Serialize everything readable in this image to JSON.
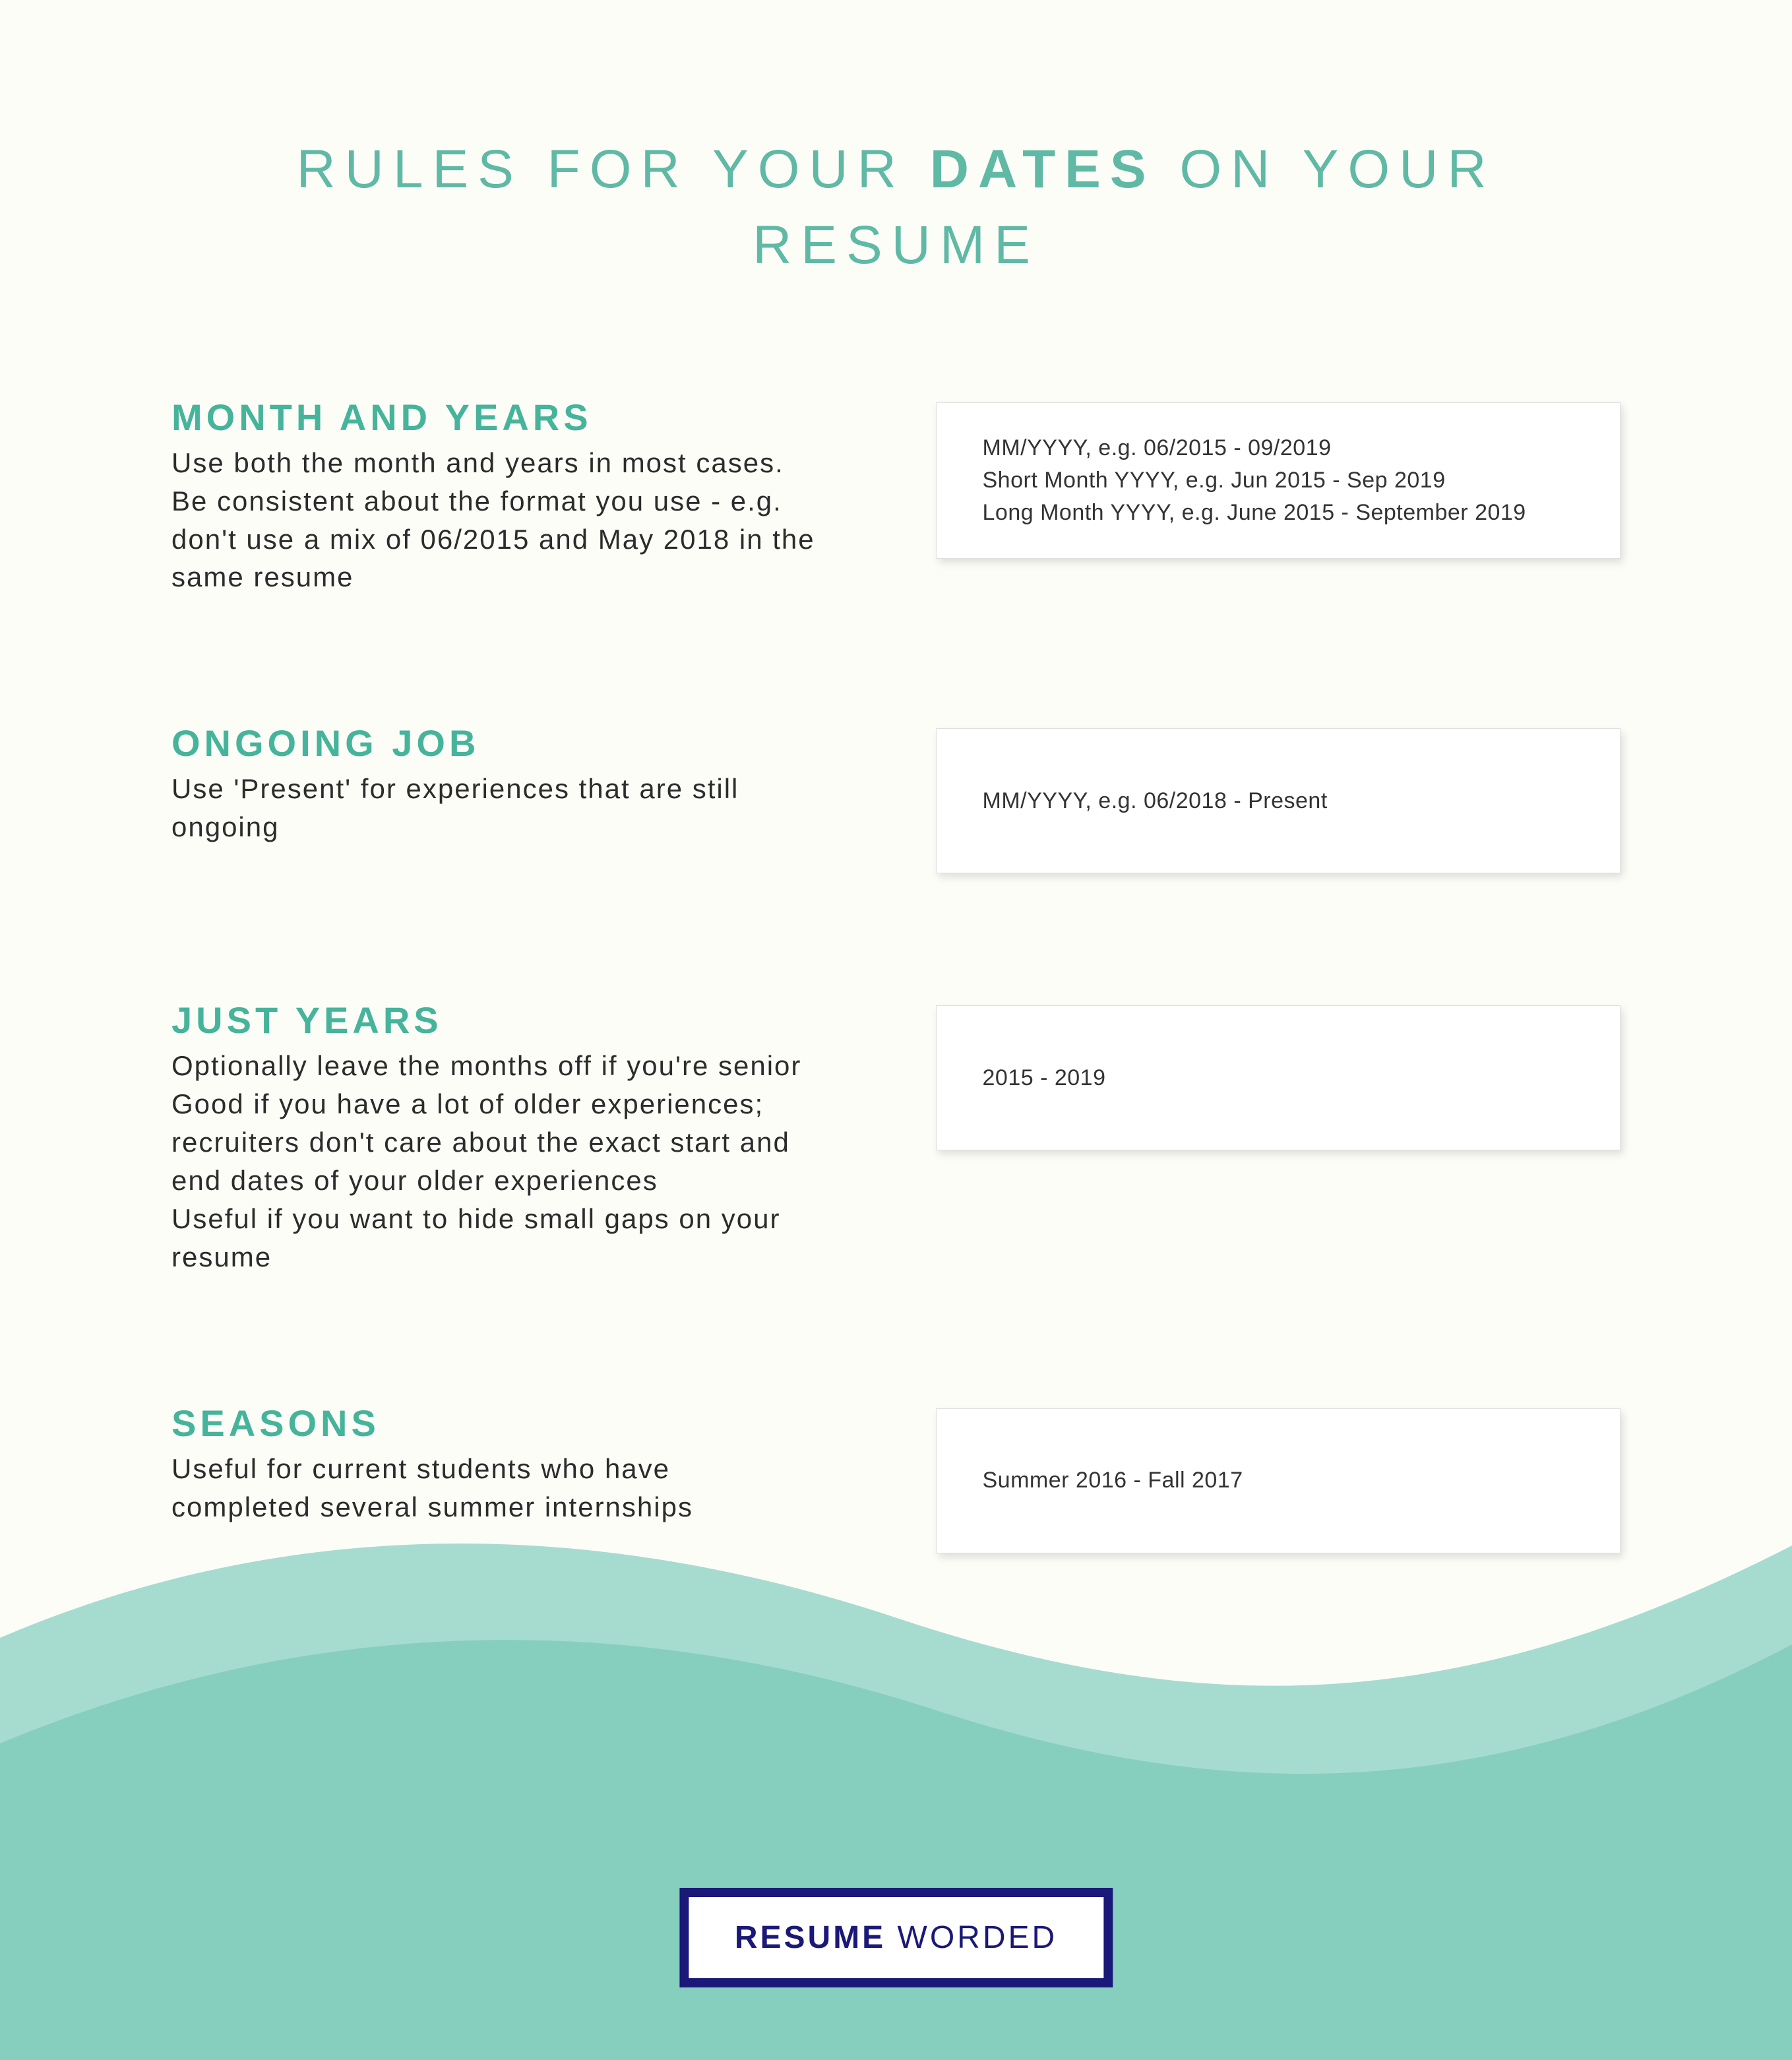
{
  "title": {
    "pre": "RULES FOR YOUR ",
    "bold": "DATES",
    "post": " ON YOUR",
    "line2": "RESUME"
  },
  "sections": [
    {
      "heading": "MONTH AND YEARS",
      "body": "Use both the month and years in most cases. Be consistent about the format you use - e.g. don't use a mix of 06/2015 and May 2018 in the same resume",
      "examples": [
        "MM/YYYY, e.g. 06/2015 - 09/2019",
        "Short Month YYYY, e.g. Jun 2015 - Sep 2019",
        "Long Month YYYY, e.g. June 2015 - September 2019"
      ]
    },
    {
      "heading": "ONGOING JOB",
      "body": "Use 'Present' for experiences that are still ongoing",
      "examples": [
        "MM/YYYY, e.g. 06/2018 - Present"
      ]
    },
    {
      "heading": "JUST YEARS",
      "body": "Optionally leave the months off if you're senior\nGood if you have a lot of older experiences; recruiters don't care about the exact start and end dates of your older experiences\nUseful if you want to hide small gaps on your resume",
      "examples": [
        "2015 - 2019"
      ]
    },
    {
      "heading": "SEASONS",
      "body": "Useful for current students who have completed several summer internships",
      "examples": [
        "Summer 2016 - Fall 2017"
      ]
    }
  ],
  "logo": {
    "bold": "RESUME",
    "rest": " WORDED"
  },
  "colors": {
    "accent": "#5fb9a5",
    "wave1": "#a6dccf",
    "wave2": "#86cfbe",
    "logoBorder": "#1a1878"
  }
}
